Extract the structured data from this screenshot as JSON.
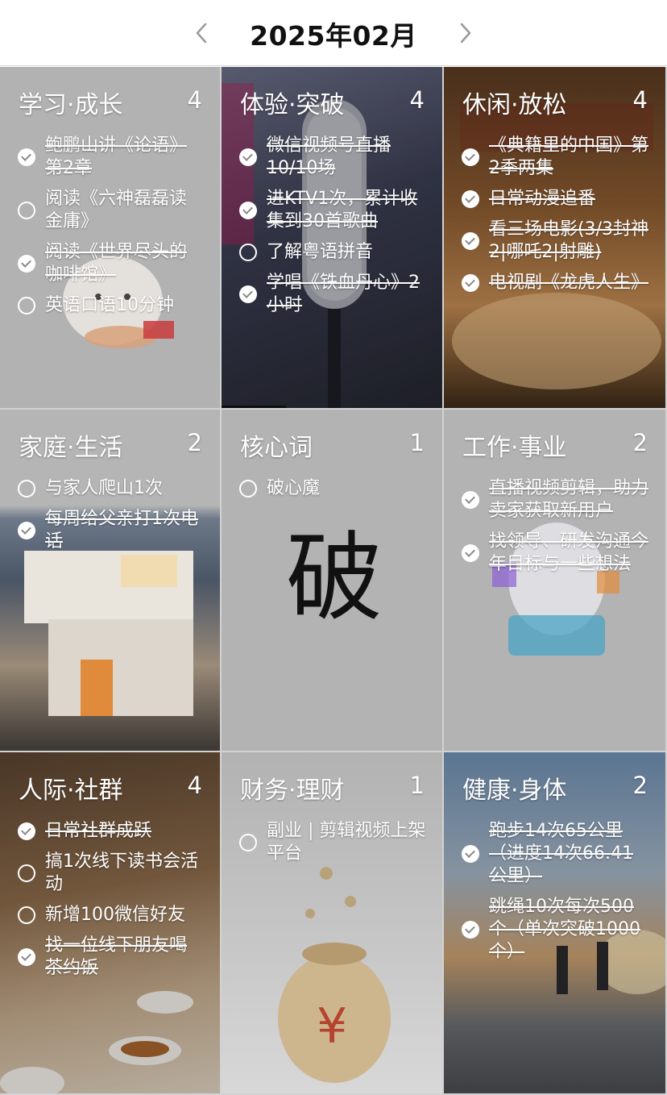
{
  "header": {
    "title": "2025年02月"
  },
  "cells": [
    {
      "category": "学习·成长",
      "count": "4",
      "tasks": [
        {
          "text": "鲍鹏山讲《论语》第2章",
          "done": true
        },
        {
          "text": "阅读《六神磊磊读金庸》",
          "done": false
        },
        {
          "text": "阅读《世界尽头的咖啡馆》",
          "done": true
        },
        {
          "text": "英语口语10分钟",
          "done": false
        }
      ]
    },
    {
      "category": "体验·突破",
      "count": "4",
      "tasks": [
        {
          "text": "微信视频号直播10/10场",
          "done": true
        },
        {
          "text": "进KTV1次，累计收集到30首歌曲",
          "done": true
        },
        {
          "text": "了解粤语拼音",
          "done": false
        },
        {
          "text": "学唱《铁血丹心》2小时",
          "done": true
        }
      ]
    },
    {
      "category": "休闲·放松",
      "count": "4",
      "tasks": [
        {
          "text": "《典籍里的中国》第2季两集",
          "done": true
        },
        {
          "text": "日常动漫追番",
          "done": true
        },
        {
          "text": "看三场电影(3/3封神2|哪吒2|射雕)",
          "done": true
        },
        {
          "text": "电视剧《龙虎人生》",
          "done": true
        }
      ]
    },
    {
      "category": "家庭·生活",
      "count": "2",
      "tasks": [
        {
          "text": "与家人爬山1次",
          "done": false
        },
        {
          "text": "每周给父亲打1次电话",
          "done": true
        }
      ]
    },
    {
      "category": "核心词",
      "count": "1",
      "tasks": [
        {
          "text": "破心魔",
          "done": false
        }
      ],
      "big_char": "破"
    },
    {
      "category": "工作·事业",
      "count": "2",
      "tasks": [
        {
          "text": "直播视频剪辑，助力卖家获取新用户",
          "done": true
        },
        {
          "text": "找领导、研发沟通今年目标与一些想法",
          "done": true
        }
      ]
    },
    {
      "category": "人际·社群",
      "count": "4",
      "tasks": [
        {
          "text": "日常社群成跃",
          "done": true
        },
        {
          "text": "搞1次线下读书会活动",
          "done": false
        },
        {
          "text": "新增100微信好友",
          "done": false
        },
        {
          "text": "找一位线下朋友喝茶约饭",
          "done": true
        }
      ]
    },
    {
      "category": "财务·理财",
      "count": "1",
      "tasks": [
        {
          "text": "副业 | 剪辑视频上架平台",
          "done": false
        }
      ]
    },
    {
      "category": "健康·身体",
      "count": "2",
      "tasks": [
        {
          "text": "跑步14次65公里（进度14次66.41公里）",
          "done": true
        },
        {
          "text": "跳绳10次每次500个（单次突破1000个）",
          "done": true
        }
      ]
    }
  ]
}
